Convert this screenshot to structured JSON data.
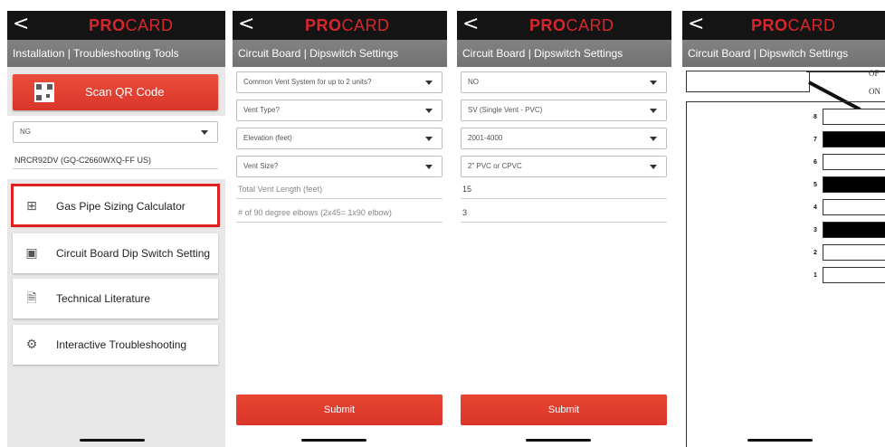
{
  "brand": {
    "part1": "PRO",
    "part2": "CARD"
  },
  "back_glyph": "<",
  "screen1": {
    "subtitle": "Installation | Troubleshooting Tools",
    "scan_label": "Scan QR Code",
    "gas_select": "NG",
    "model": "NRCR92DV (GQ-C2660WXQ-FF US)",
    "menu": [
      {
        "label": "Gas Pipe Sizing Calculator",
        "icon": "calculator-icon",
        "glyph": "⊞"
      },
      {
        "label": "Circuit Board Dip Switch Setting",
        "icon": "dip-switch-icon",
        "glyph": "▣"
      },
      {
        "label": "Technical Literature",
        "icon": "document-icon",
        "glyph": "🗎"
      },
      {
        "label": "Interactive Troubleshooting",
        "icon": "gear-icon",
        "glyph": "⚙"
      }
    ]
  },
  "screen2": {
    "subtitle": "Circuit Board | Dipswitch Settings",
    "selects": [
      "Common Vent System for up to 2 units?",
      "Vent Type?",
      "Elevation (feet)",
      "Vent Size?"
    ],
    "inputs": [
      "Total Vent Length (feet)",
      "# of 90 degree elbows (2x45= 1x90 elbow)"
    ],
    "submit": "Submit"
  },
  "screen3": {
    "subtitle": "Circuit Board | Dipswitch Settings",
    "selects": [
      "NO",
      "SV (Single Vent - PVC)",
      "2001-4000",
      "2\" PVC or CPVC"
    ],
    "inputs": [
      "15",
      "3"
    ],
    "submit": "Submit"
  },
  "screen4": {
    "subtitle": "Circuit Board | Dipswitch Settings",
    "off_label": "OF",
    "on_label": "ON",
    "switches": [
      {
        "num": "8",
        "on": false
      },
      {
        "num": "7",
        "on": true
      },
      {
        "num": "6",
        "on": false
      },
      {
        "num": "5",
        "on": true
      },
      {
        "num": "4",
        "on": false
      },
      {
        "num": "3",
        "on": true
      },
      {
        "num": "2",
        "on": false
      },
      {
        "num": "1",
        "on": false
      }
    ]
  },
  "colors": {
    "brand_red": "#d9262d",
    "button_red": "#e04432",
    "highlight": "#e02020",
    "topbar": "#141414"
  }
}
